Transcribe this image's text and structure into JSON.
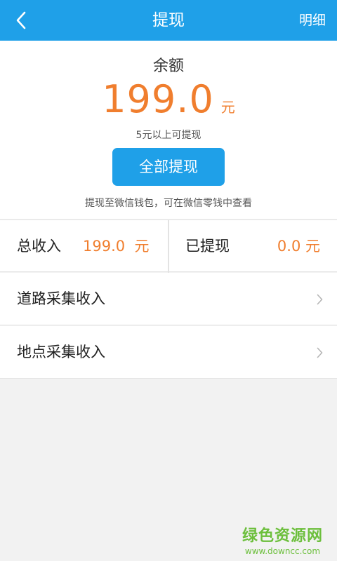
{
  "header": {
    "title": "提现",
    "right_label": "明细"
  },
  "balance": {
    "label": "余额",
    "amount": "199.0",
    "unit": "元",
    "min_note": "5元以上可提现",
    "withdraw_label": "全部提现",
    "wechat_note": "提现至微信钱包，可在微信零钱中查看"
  },
  "stats": {
    "total_label": "总收入",
    "total_value": "199.0  元",
    "withdrawn_label": "已提现",
    "withdrawn_value": "0.0 元"
  },
  "list": [
    {
      "label": "道路采集收入"
    },
    {
      "label": "地点采集收入"
    }
  ],
  "watermark": {
    "title": "绿色资源网",
    "url": "www.downcc.com"
  },
  "colors": {
    "primary": "#1fa0e8",
    "accent": "#f07e2e",
    "background": "#f2f2f2",
    "watermark": "#6cbf3c"
  }
}
